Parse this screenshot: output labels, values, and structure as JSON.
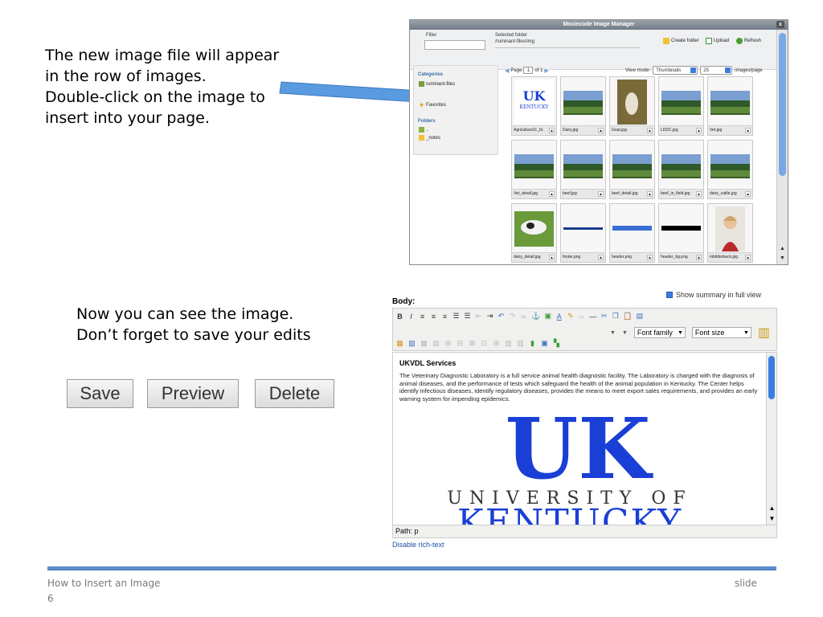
{
  "instructions_top": [
    "The new image file will appear",
    "in the row of images.",
    "Double-click on the image to",
    "insert into your page."
  ],
  "instructions_bottom": [
    "Now you can see the image.",
    "Don’t forget to save your edits"
  ],
  "buttons": {
    "save": "Save",
    "preview": "Preview",
    "delete": "Delete"
  },
  "image_manager": {
    "title": "Moxiecode Image Manager",
    "close": "x",
    "filter_label": "Filter",
    "selected_folder_label": "Selected folder",
    "selected_folder_path": "/ruminant-files/img",
    "create_folder": "Create folder",
    "upload": "Upload",
    "refresh": "Refresh",
    "categories_heading": "Categories",
    "category_item": "ruminant-files",
    "favorites": "Favorites",
    "folders_heading": "Folders",
    "folder_up": "..",
    "folder_notes": "_notes",
    "page_label": "Page",
    "page_value": "1",
    "page_of": "of 1",
    "view_mode_label": "View mode:",
    "view_mode_value": "Thumbnails",
    "per_page_value": "25",
    "per_page_label": "images/page",
    "thumbnails": [
      {
        "caption": "Agriculture2c_bl.",
        "kind": "uk-logo"
      },
      {
        "caption": "Dairy.jpg",
        "kind": "field"
      },
      {
        "caption": "Goat.jpg",
        "kind": "goat"
      },
      {
        "caption": "LDDC.jpg",
        "kind": "field"
      },
      {
        "caption": "Vet.jpg",
        "kind": "field"
      },
      {
        "caption": "Vet_detail.jpg",
        "kind": "field"
      },
      {
        "caption": "beef.jpg",
        "kind": "field"
      },
      {
        "caption": "beef_detail.jpg",
        "kind": "field"
      },
      {
        "caption": "beef_in_field.jpg",
        "kind": "field"
      },
      {
        "caption": "dairy_cattle.jpg",
        "kind": "field"
      },
      {
        "caption": "dairy_detail.jpg",
        "kind": "cow"
      },
      {
        "caption": "footer.png",
        "kind": "stripe"
      },
      {
        "caption": "header.png",
        "kind": "bluebar"
      },
      {
        "caption": "header_bg.png",
        "kind": "blackbar"
      },
      {
        "caption": "mbilderback.jpg",
        "kind": "person"
      }
    ]
  },
  "editor": {
    "summary_toggle": "Show summary in full view",
    "body_label": "Body:",
    "font_family": "Font family",
    "font_size": "Font size",
    "content_heading": "UKVDL Services",
    "content_paragraph": "The Veterinary Diagnostic Laboratory is a full service animal health diagnostic facility. The Laboratory is charged with the diagnosis of animal diseases, and the performance of tests which safeguard the health of the animal population in Kentucky. The Center helps identify infectious diseases, identify regulatory diseases, provides the means to meet export sales requirements, and provides an early warning system for impending epidemics.",
    "logo_line1": "UK",
    "logo_line2": "UNIVERSITY OF",
    "logo_line3": "KENTUCKY",
    "path": "Path: p",
    "disable_rich_text": "Disable rich-text"
  },
  "footer": {
    "title": "How to Insert an Image",
    "slide_label": "slide",
    "slide_number": "6"
  },
  "colors": {
    "accent": "#5b8fd0",
    "uk_blue": "#1a3fd6",
    "arrow": "#5a9be0"
  }
}
